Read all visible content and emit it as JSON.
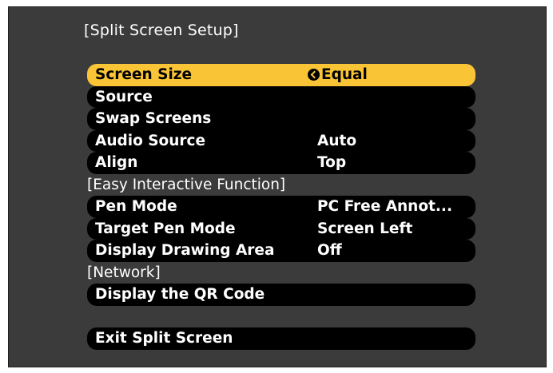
{
  "title": "[Split Screen Setup]",
  "items": {
    "screen_size": {
      "label": "Screen Size",
      "value": "Equal"
    },
    "source": {
      "label": "Source",
      "value": ""
    },
    "swap_screens": {
      "label": "Swap Screens",
      "value": ""
    },
    "audio_source": {
      "label": "Audio Source",
      "value": "Auto"
    },
    "align": {
      "label": "Align",
      "value": "Top"
    },
    "easy_interactive_header": "[Easy Interactive Function]",
    "pen_mode": {
      "label": "Pen Mode",
      "value": "PC Free Annot..."
    },
    "target_pen_mode": {
      "label": "Target Pen Mode",
      "value": "Screen Left"
    },
    "display_drawing_area": {
      "label": "Display Drawing Area",
      "value": "Off"
    },
    "network_header": "[Network]",
    "display_qr_code": {
      "label": "Display the QR Code",
      "value": ""
    },
    "exit_split_screen": {
      "label": "Exit Split Screen",
      "value": ""
    }
  },
  "selected_item": "screen_size",
  "colors": {
    "background": "#3b3b3b",
    "item_bg": "#000000",
    "selected_bg": "#f9c435",
    "text": "#ffffff"
  },
  "icons": {
    "screen_size_value": "enter-icon"
  }
}
